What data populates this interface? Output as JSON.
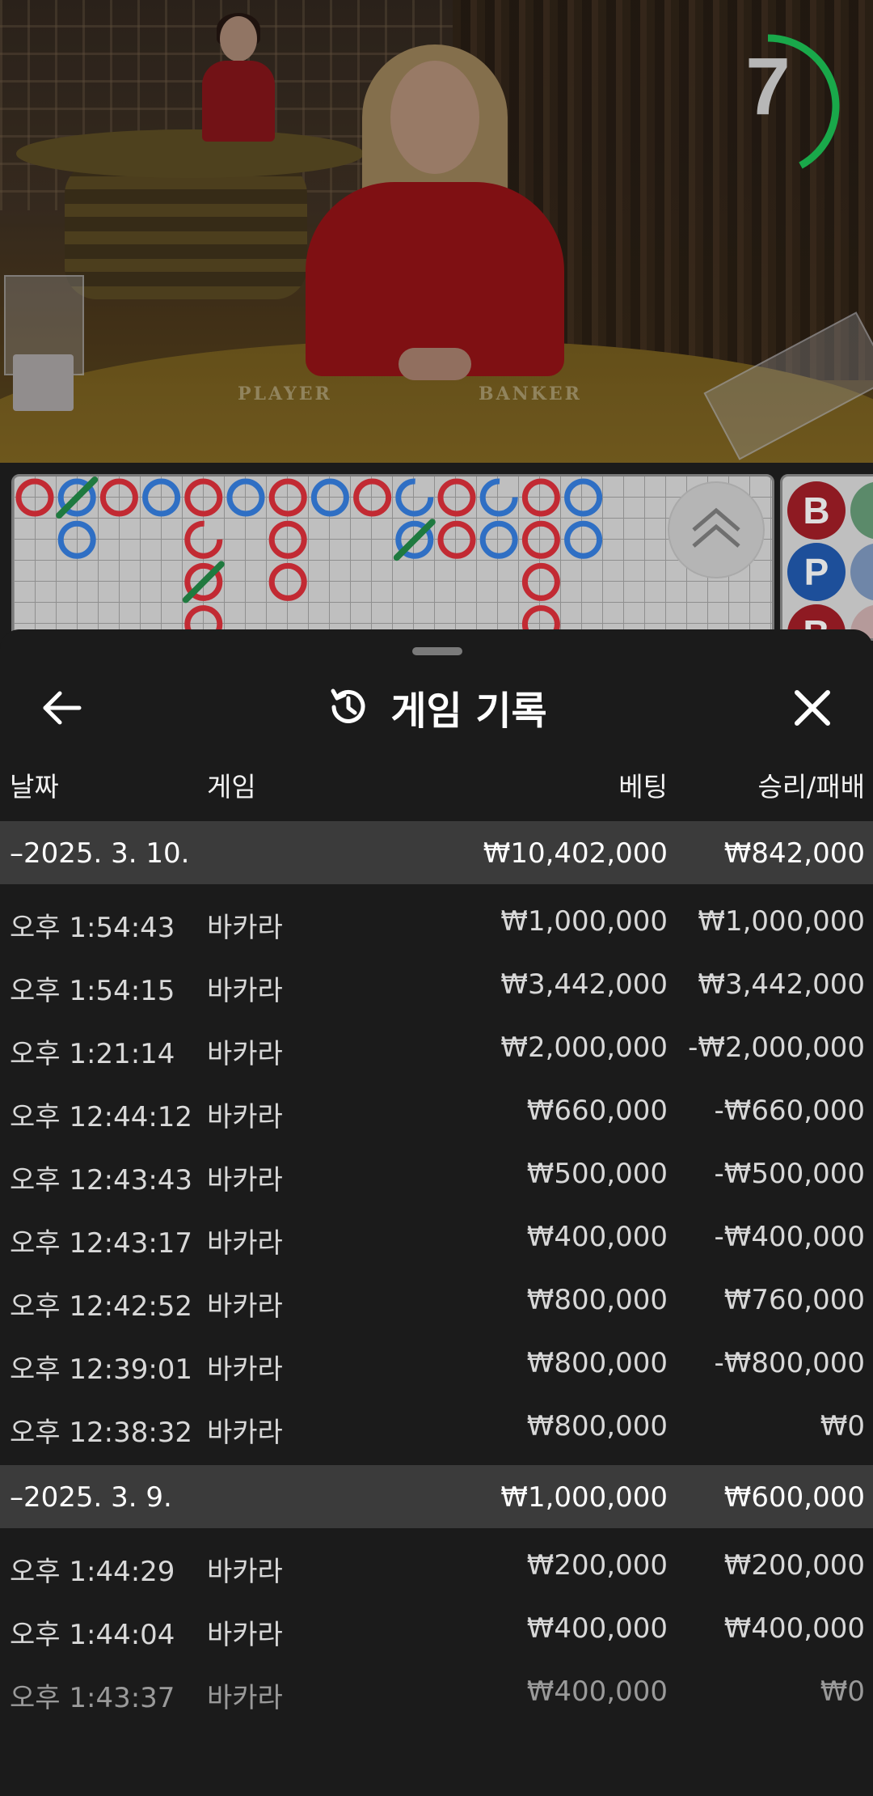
{
  "timer": {
    "countdown": "7",
    "progress": 0.42,
    "color": "#19a84a"
  },
  "table_labels": {
    "player": "PLAYER",
    "banker": "BANKER"
  },
  "roadmap": {
    "red": "#c22a33",
    "blue": "#2f6fc4",
    "green": "#1f7a3f",
    "side_beads": [
      "B",
      "P",
      "B"
    ]
  },
  "sheet": {
    "title": "게임 기록",
    "back_icon": "arrow-left-icon",
    "history_icon": "history-clock-icon",
    "close_icon": "close-x-icon",
    "columns": {
      "date": "날짜",
      "game": "게임",
      "bet": "베팅",
      "win_loss": "승리/패배"
    },
    "groups": [
      {
        "date": "–2025. 3. 10.",
        "total_bet": "₩10,402,000",
        "total_result": "₩842,000",
        "rows": [
          {
            "time": "오후 1:54:43",
            "game": "바카라",
            "bet": "₩1,000,000",
            "result": "₩1,000,000"
          },
          {
            "time": "오후 1:54:15",
            "game": "바카라",
            "bet": "₩3,442,000",
            "result": "₩3,442,000"
          },
          {
            "time": "오후 1:21:14",
            "game": "바카라",
            "bet": "₩2,000,000",
            "result": "-₩2,000,000"
          },
          {
            "time": "오후 12:44:12",
            "game": "바카라",
            "bet": "₩660,000",
            "result": "-₩660,000"
          },
          {
            "time": "오후 12:43:43",
            "game": "바카라",
            "bet": "₩500,000",
            "result": "-₩500,000"
          },
          {
            "time": "오후 12:43:17",
            "game": "바카라",
            "bet": "₩400,000",
            "result": "-₩400,000"
          },
          {
            "time": "오후 12:42:52",
            "game": "바카라",
            "bet": "₩800,000",
            "result": "₩760,000"
          },
          {
            "time": "오후 12:39:01",
            "game": "바카라",
            "bet": "₩800,000",
            "result": "-₩800,000"
          },
          {
            "time": "오후 12:38:32",
            "game": "바카라",
            "bet": "₩800,000",
            "result": "₩0"
          }
        ]
      },
      {
        "date": "–2025. 3. 9.",
        "total_bet": "₩1,000,000",
        "total_result": "₩600,000",
        "rows": [
          {
            "time": "오후 1:44:29",
            "game": "바카라",
            "bet": "₩200,000",
            "result": "₩200,000"
          },
          {
            "time": "오후 1:44:04",
            "game": "바카라",
            "bet": "₩400,000",
            "result": "₩400,000"
          },
          {
            "time": "오후 1:43:37",
            "game": "바카라",
            "bet": "₩400,000",
            "result": "₩0"
          }
        ]
      }
    ]
  }
}
